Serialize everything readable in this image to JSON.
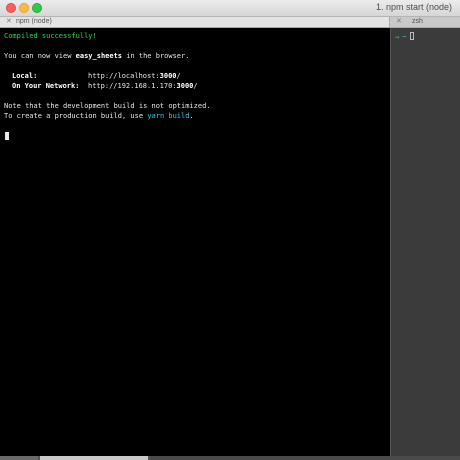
{
  "window": {
    "title": "1. npm start (node)"
  },
  "tabs": [
    {
      "label": "npm (node)",
      "close": "✕"
    },
    {
      "label": "zsh",
      "close": "✕"
    }
  ],
  "terminal": {
    "compiled": "Compiled successfully!",
    "view_prefix": "You can now view ",
    "app_name": "easy_sheets",
    "view_suffix": " in the browser.",
    "local_label": "Local:",
    "local_url_prefix": "http://localhost:",
    "local_port": "3000",
    "local_url_suffix": "/",
    "network_label": "On Your Network:",
    "network_url_prefix": "http://192.168.1.170:",
    "network_port": "3000",
    "network_url_suffix": "/",
    "note": "Note that the development build is not optimized.",
    "prod_prefix": "To create a production build, use ",
    "prod_cmd": "yarn build",
    "prod_suffix": "."
  },
  "right_pane": {
    "arrow": "→",
    "tilde": "~"
  },
  "colors": {
    "green": "#32d74b",
    "cyan": "#3fc6e8",
    "background": "#000000"
  }
}
